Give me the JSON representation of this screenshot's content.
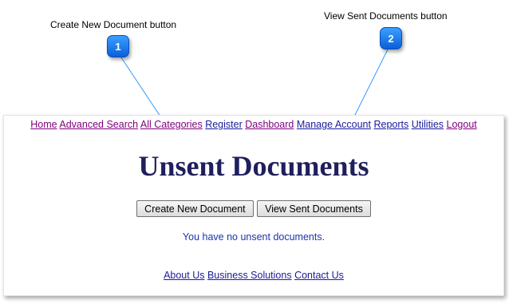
{
  "callouts": [
    {
      "number": "1",
      "label": "Create New Document button"
    },
    {
      "number": "2",
      "label": "View Sent Documents button"
    }
  ],
  "nav": {
    "items": [
      "Home",
      "Advanced Search",
      "All Categories",
      "Register",
      "Dashboard",
      "Manage Account",
      "Reports",
      "Utilities",
      "Logout"
    ]
  },
  "main": {
    "title": "Unsent Documents",
    "create_button": "Create New Document",
    "view_sent_button": "View Sent Documents",
    "empty_message": "You have no unsent documents."
  },
  "footer": {
    "links": [
      "About Us",
      "Business Solutions",
      "Contact Us"
    ]
  },
  "colors": {
    "title": "#1f1f5e",
    "visited_link": "#800080",
    "link": "#1a1a9c",
    "callout_badge": "#1877e8",
    "leader_line": "#3399ff"
  }
}
